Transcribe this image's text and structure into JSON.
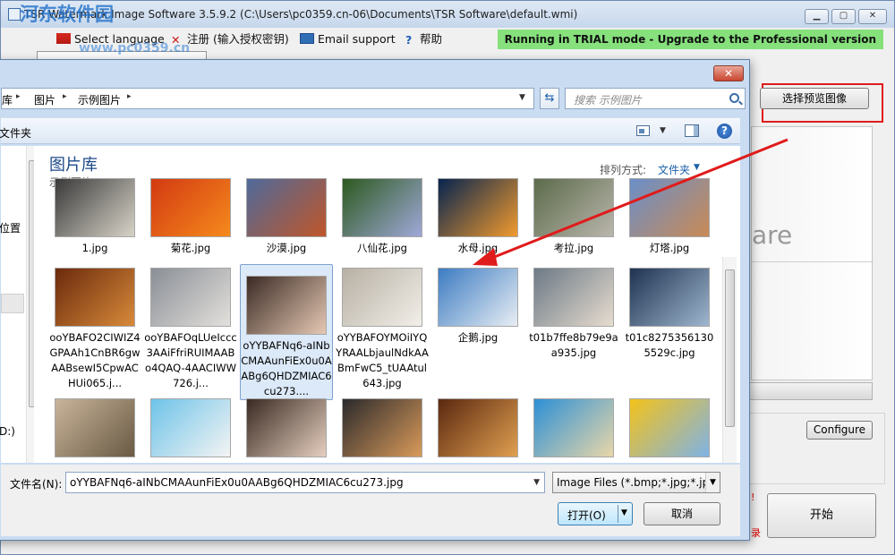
{
  "window": {
    "title": "TSR Watermark Image Software 3.5.9.2 (C:\\Users\\pc0359.cn-06\\Documents\\TSR Software\\default.wmi)",
    "minimize": "▁",
    "maximize": "▢",
    "close": "✕"
  },
  "watermark": {
    "site_name": "河东软件园",
    "url": "www.pc0359.cn"
  },
  "menu": {
    "items": [
      {
        "label": "Select language"
      },
      {
        "label": "注册 (输入授权密钥)"
      },
      {
        "label": "Email support"
      },
      {
        "label": "帮助"
      }
    ],
    "trial_notice": "Running in TRIAL mode - Upgrade to the Professional version"
  },
  "right_panel": {
    "preview_button": "选择预览图像",
    "preview_text": "are",
    "configure_button": "Configure",
    "start_button": "开始",
    "red_marks": [
      "!",
      "录"
    ]
  },
  "dialog": {
    "close": "✕",
    "breadcrumb": [
      "库",
      "图片",
      "示例图片"
    ],
    "search_placeholder": "搜索 示例图片",
    "toolbar_left": "文件夹",
    "nav_labels": [
      "位置",
      "D:)"
    ],
    "library_title": "图片库",
    "library_subtitle": "示例图片",
    "sort_label": "排列方式:",
    "sort_value": "文件夹",
    "files": [
      {
        "name": "1.jpg",
        "colors": [
          "#3a3a3a",
          "#d8d3c8"
        ]
      },
      {
        "name": "菊花.jpg",
        "colors": [
          "#d23a12",
          "#f58a1c"
        ]
      },
      {
        "name": "沙漠.jpg",
        "colors": [
          "#4e6a9a",
          "#c0562a"
        ]
      },
      {
        "name": "八仙花.jpg",
        "colors": [
          "#2d5a1f",
          "#9fa8d8"
        ]
      },
      {
        "name": "水母.jpg",
        "colors": [
          "#06244f",
          "#f19a2e"
        ]
      },
      {
        "name": "考拉.jpg",
        "colors": [
          "#5c6b4a",
          "#b9b6ac"
        ]
      },
      {
        "name": "灯塔.jpg",
        "colors": [
          "#6a8fc9",
          "#c98a55"
        ]
      },
      {
        "name": "ooYBAFO2CIWIZ4GPAAh1CnBR6gwAABsewI5CpwACHUi065.j...",
        "colors": [
          "#6b2a0c",
          "#d88a3a"
        ]
      },
      {
        "name": "ooYBAFOqLUeIccc3AAiFfriRUIMAABo4QAQ-4AACIWW726.j...",
        "colors": [
          "#8a8f96",
          "#e3e0dc"
        ]
      },
      {
        "name": "oYYBAFNq6-aINbCMAAunFiEx0u0AABg6QHDZMIAC6cu273....",
        "colors": [
          "#3b2a24",
          "#e6c9b4"
        ]
      },
      {
        "name": "oYYBAFOYMOiIYQYRAALbjaulNdkAABmFwC5_tUAAtul643.jpg",
        "colors": [
          "#b7b0a4",
          "#f2efe9"
        ]
      },
      {
        "name": "企鹅.jpg",
        "colors": [
          "#3c7cc2",
          "#e8eef4"
        ]
      },
      {
        "name": "t01b7ffe8b79e9aa935.jpg",
        "colors": [
          "#6d7a86",
          "#e6dccf"
        ]
      },
      {
        "name": "t01c82753561305529c.jpg",
        "colors": [
          "#1f3350",
          "#9eb6cf"
        ]
      },
      {
        "name": "",
        "colors": [
          "#c8b49a",
          "#6a5a44"
        ]
      },
      {
        "name": "",
        "colors": [
          "#6ec3e8",
          "#f4f4f4"
        ]
      },
      {
        "name": "",
        "colors": [
          "#3a2a22",
          "#e5cfbf"
        ]
      },
      {
        "name": "",
        "colors": [
          "#2b2a2c",
          "#d99a5a"
        ]
      },
      {
        "name": "",
        "colors": [
          "#5b2810",
          "#e0a050"
        ]
      },
      {
        "name": "",
        "colors": [
          "#2d90d6",
          "#e8d7a8"
        ]
      },
      {
        "name": "",
        "colors": [
          "#f4c21a",
          "#7fb3e6"
        ]
      }
    ],
    "selected_index": 9,
    "filename_label": "文件名(N):",
    "filename_value": "oYYBAFNq6-aINbCMAAunFiEx0u0AABg6QHDZMIAC6cu273.jpg",
    "filter_value": "Image Files (*.bmp;*.jpg;*.jpe",
    "open_button": "打开(O)",
    "cancel_button": "取消"
  },
  "colors": {
    "accent": "#1e4a8a",
    "trial_bg": "#86e07c",
    "annotation_red": "#e01b1b"
  }
}
